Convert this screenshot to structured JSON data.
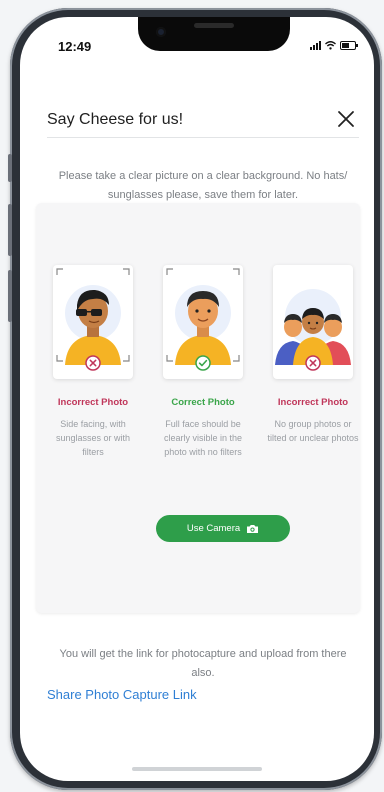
{
  "status_bar": {
    "time": "12:49"
  },
  "header": {
    "title": "Say Cheese for us!",
    "close_icon": "close-icon"
  },
  "instructions": "Please take a clear picture on a clear background. No hats/ sunglasses please, save them for later.",
  "examples": [
    {
      "label": "Incorrect Photo",
      "description": "Side facing, with sunglasses or with filters",
      "status": "incorrect",
      "color": "#c0365a",
      "icon": "cross-icon"
    },
    {
      "label": "Correct Photo",
      "description": "Full face should be clearly visible in the photo with no filters",
      "status": "correct",
      "color": "#3aa54a",
      "icon": "check-icon"
    },
    {
      "label": "Incorrect Photo",
      "description": "No group photos or tilted or unclear photos",
      "status": "incorrect",
      "color": "#c0365a",
      "icon": "cross-icon"
    }
  ],
  "camera_button": {
    "label": "Use Camera",
    "icon": "camera-icon",
    "color": "#2e9e4a"
  },
  "link_note": "You will get the link for photocapture and upload from there also.",
  "share_link": {
    "label": "Share Photo Capture Link",
    "color": "#2f7fd4"
  }
}
